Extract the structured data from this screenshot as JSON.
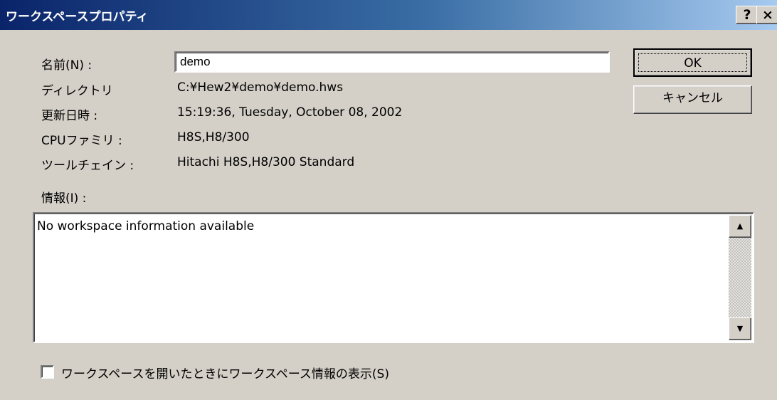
{
  "window": {
    "title": "ワークスペースプロパティ",
    "help_label": "?",
    "close_label": "×"
  },
  "fields": {
    "name_label": "名前(N) :",
    "name_value": "demo",
    "directory_label": "ディレクトリ",
    "directory_value": "C:¥Hew2¥demo¥demo.hws",
    "modified_label": "更新日時 :",
    "modified_value": "15:19:36, Tuesday, October 08, 2002",
    "cpu_family_label": "CPUファミリ :",
    "cpu_family_value": "H8S,H8/300",
    "toolchain_label": "ツールチェイン :",
    "toolchain_value": "Hitachi H8S,H8/300 Standard",
    "info_label": "情報(I) :",
    "info_text": "No workspace information available"
  },
  "buttons": {
    "ok": "OK",
    "cancel": "キャンセル"
  },
  "scrollbar": {
    "up": "▲",
    "down": "▼"
  },
  "checkbox": {
    "label": "ワークスペースを開いたときにワークスペース情報の表示(S)",
    "checked": false
  }
}
